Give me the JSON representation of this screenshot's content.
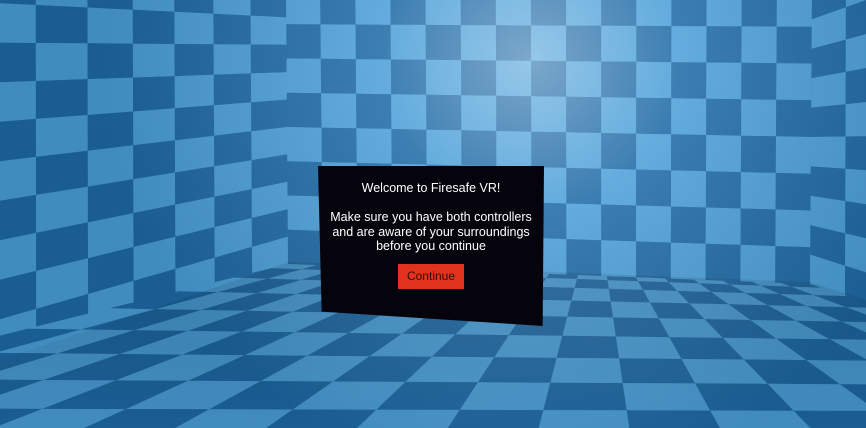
{
  "scene": {
    "environment": "checkered-room",
    "colors": {
      "tile_light": "#4a9fd8",
      "tile_dark": "#1e6aa6",
      "highlight": "#9fd4f4"
    }
  },
  "dialog": {
    "title": "Welcome to Firesafe VR!",
    "message": "Make sure you have both controllers and are aware of your surroundings before you continue",
    "continue_label": "Continue",
    "background_color": "#05040c",
    "button_color": "#e0321c"
  }
}
